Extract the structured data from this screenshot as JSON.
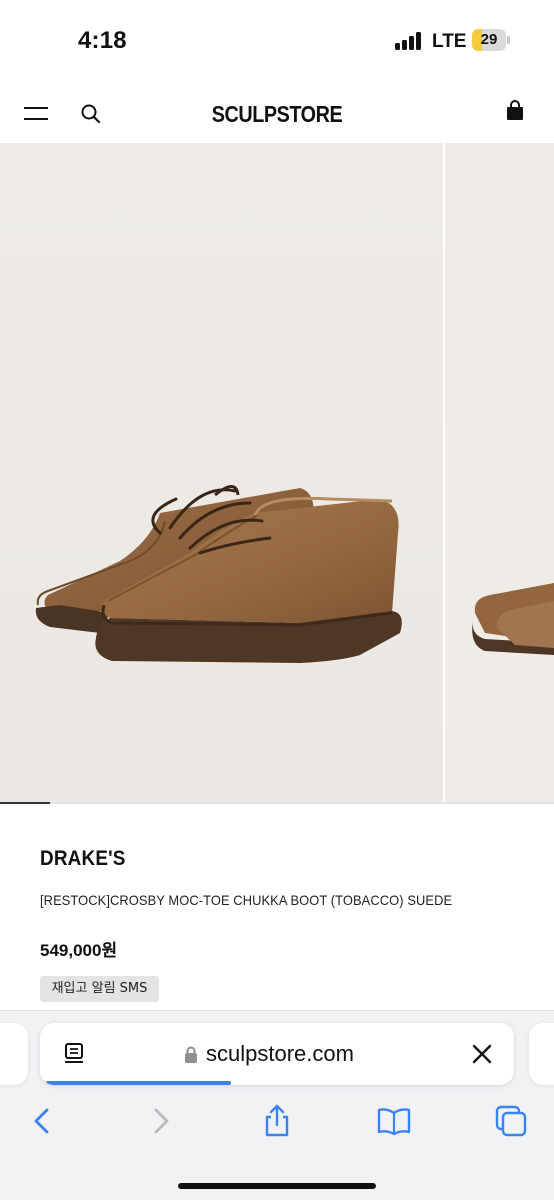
{
  "status": {
    "time": "4:18",
    "network": "LTE",
    "battery": "29",
    "battery_level": 0.29
  },
  "header": {
    "logo": "SCULPSTORE",
    "icons": [
      "menu-icon",
      "search-icon",
      "shopping-bag-icon"
    ]
  },
  "gallery": {
    "image": "Tobacco suede chukka boots pair",
    "progress": 0.09
  },
  "product": {
    "brand": "DRAKE'S",
    "name": "[RESTOCK]CROSBY MOC-TOE CHUKKA BOOT (TOBACCO) SUEDE",
    "price": "549,000원",
    "restock_label": "재입고 알림 SMS"
  },
  "browser": {
    "url": "sculpstore.com",
    "load_progress": 0.39,
    "toolbar": [
      "back-icon",
      "forward-icon",
      "share-icon",
      "bookmarks-icon",
      "tabs-icon"
    ]
  },
  "colors": {
    "accent_blue": "#3a82f7",
    "battery_yellow": "#f2cc3a",
    "suede": "#9a6d45"
  }
}
